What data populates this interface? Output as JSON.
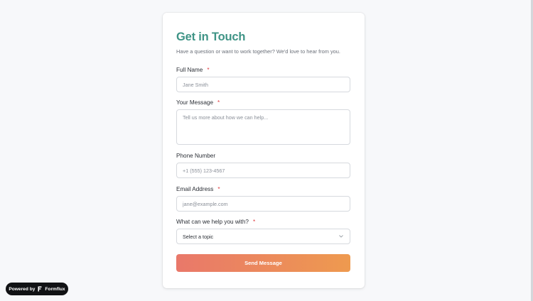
{
  "form": {
    "title": "Get in Touch",
    "subtitle": "Have a question or want to work together? We'd love to hear from you.",
    "required_marker": "*",
    "fields": {
      "full_name": {
        "label": "Full Name",
        "placeholder": "Jane Smith",
        "value": ""
      },
      "message": {
        "label": "Your Message",
        "placeholder": "Tell us more about how we can help...",
        "value": ""
      },
      "phone": {
        "label": "Phone Number",
        "placeholder": "+1 (555) 123-4567",
        "value": ""
      },
      "email": {
        "label": "Email Address",
        "placeholder": "jane@example.com",
        "value": ""
      },
      "topic": {
        "label": "What can we help you with?",
        "selected": "Select a topic"
      }
    },
    "submit_label": "Send Message"
  },
  "badge": {
    "prefix": "Powered by",
    "brand": "Formflux"
  },
  "colors": {
    "title": "#3f9486",
    "required": "#e0393e",
    "button_start": "#e9786a",
    "button_end": "#ee9a4f"
  },
  "icons": {
    "select_chevron": "chevron-down-icon",
    "brand_logo": "formflux-logo-icon"
  }
}
